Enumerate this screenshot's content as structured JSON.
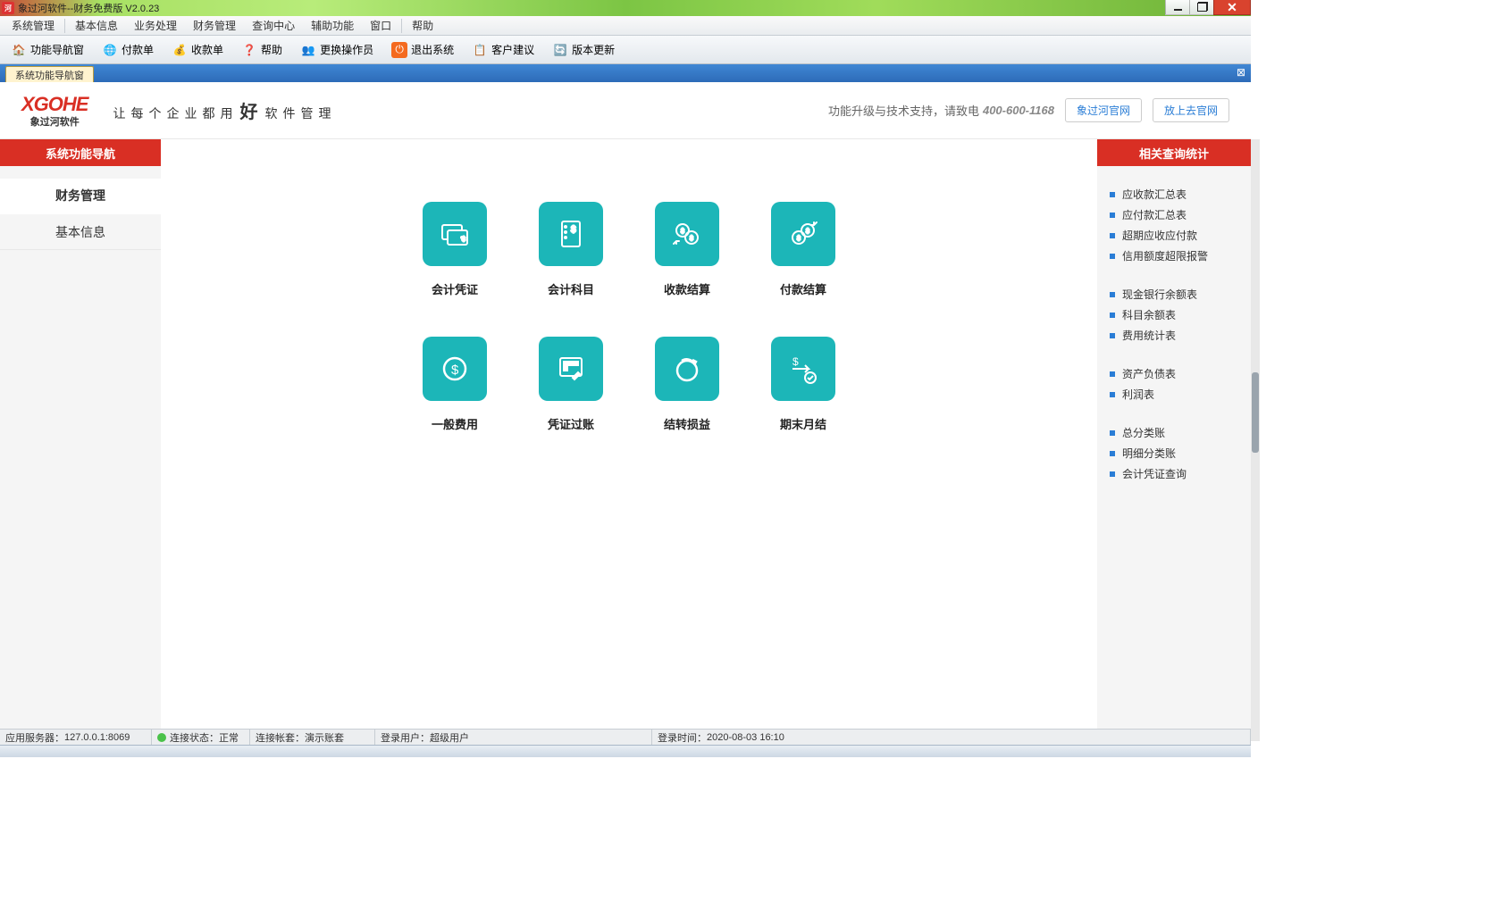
{
  "window": {
    "title": "象过河软件--财务免费版 V2.0.23"
  },
  "menu": [
    "系统管理",
    "基本信息",
    "业务处理",
    "财务管理",
    "查询中心",
    "辅助功能",
    "窗口",
    "帮助"
  ],
  "toolbar": [
    {
      "label": "功能导航窗",
      "icon": "home"
    },
    {
      "label": "付款单",
      "icon": "globe"
    },
    {
      "label": "收款单",
      "icon": "coins"
    },
    {
      "label": "帮助",
      "icon": "help"
    },
    {
      "label": "更换操作员",
      "icon": "user"
    },
    {
      "label": "退出系统",
      "icon": "power"
    },
    {
      "label": "客户建议",
      "icon": "note"
    },
    {
      "label": "版本更新",
      "icon": "refresh"
    }
  ],
  "tab": {
    "title": "系统功能导航窗"
  },
  "brand": {
    "logo": "XGOHE",
    "logosub": "象过河软件",
    "slogan_pre": "让每个企业都用",
    "slogan_hao": "好",
    "slogan_post": "软件管理",
    "support": "功能升级与技术支持，请致电",
    "phone": "400-600-1168",
    "link1": "象过河官网",
    "link2": "放上去官网"
  },
  "left": {
    "header": "系统功能导航",
    "items": [
      {
        "label": "财务管理",
        "active": true
      },
      {
        "label": "基本信息",
        "active": false
      }
    ]
  },
  "tiles": [
    {
      "label": "会计凭证",
      "icon": "voucher"
    },
    {
      "label": "会计科目",
      "icon": "subject"
    },
    {
      "label": "收款结算",
      "icon": "receive"
    },
    {
      "label": "付款结算",
      "icon": "pay"
    },
    {
      "label": "一般费用",
      "icon": "expense"
    },
    {
      "label": "凭证过账",
      "icon": "post"
    },
    {
      "label": "结转损益",
      "icon": "carry"
    },
    {
      "label": "期末月结",
      "icon": "monthend"
    }
  ],
  "right": {
    "header": "相关查询统计",
    "groups": [
      [
        "应收款汇总表",
        "应付款汇总表",
        "超期应收应付款",
        "信用额度超限报警"
      ],
      [
        "现金银行余额表",
        "科目余额表",
        "费用统计表"
      ],
      [
        "资产负债表",
        "利润表"
      ],
      [
        "总分类账",
        "明细分类账",
        "会计凭证查询"
      ]
    ]
  },
  "status": {
    "server_lbl": "应用服务器：",
    "server": "127.0.0.1:8069",
    "conn_lbl": "连接状态：",
    "conn": "正常",
    "acct_lbl": "连接帐套：",
    "acct": "演示账套",
    "user_lbl": "登录用户：",
    "user": "超级用户",
    "time_lbl": "登录时间：",
    "time": "2020-08-03 16:10"
  }
}
